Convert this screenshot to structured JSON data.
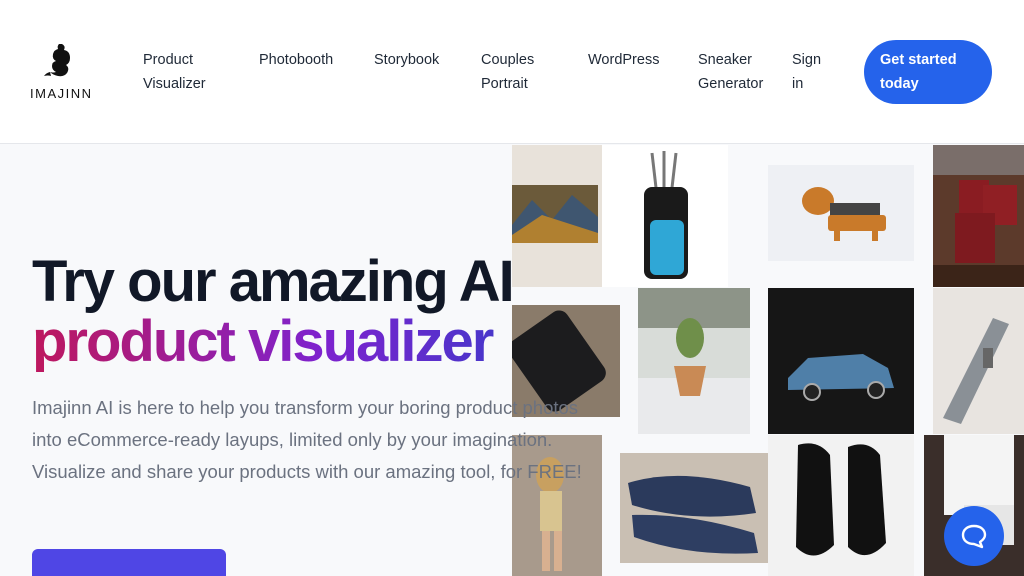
{
  "brand": {
    "name": "IMAJINN",
    "logo_icon": "genie-logo-icon"
  },
  "nav": {
    "items": [
      {
        "line1": "Product",
        "line2": "Visualizer"
      },
      {
        "line1": "Photobooth",
        "line2": ""
      },
      {
        "line1": "Storybook",
        "line2": ""
      },
      {
        "line1": "Couples",
        "line2": "Portrait"
      },
      {
        "line1": "WordPress",
        "line2": ""
      },
      {
        "line1": "Sneaker",
        "line2": "Generator"
      },
      {
        "line1": "Sign",
        "line2": "in"
      }
    ],
    "cta": {
      "line1": "Get started",
      "line2": "today"
    }
  },
  "hero": {
    "title_line1": "Try our amazing AI",
    "title_line2": "product visualizer",
    "description": "Imajinn AI is here to help you transform your boring product photos into eCommerce-ready layups, limited only by your imagination. Visualize and share your products with our amazing tool, for FREE!"
  },
  "collage": {
    "images": [
      "painting-photo",
      "golf-bag-photo",
      "slinky-dog-toy-photo",
      "candles-photo",
      "smartphone-photo",
      "cactus-photo",
      "toy-car-photo",
      "model-ship-photo",
      "doll-photo",
      "blue-sneakers-photo",
      "black-sneakers-photo",
      "console-photo"
    ]
  },
  "colors": {
    "primary": "#2563eb",
    "button": "#4f46e5",
    "gradient_start": "#be185d",
    "gradient_end": "#4338ca"
  },
  "chat": {
    "icon": "chat-bubble-icon"
  }
}
